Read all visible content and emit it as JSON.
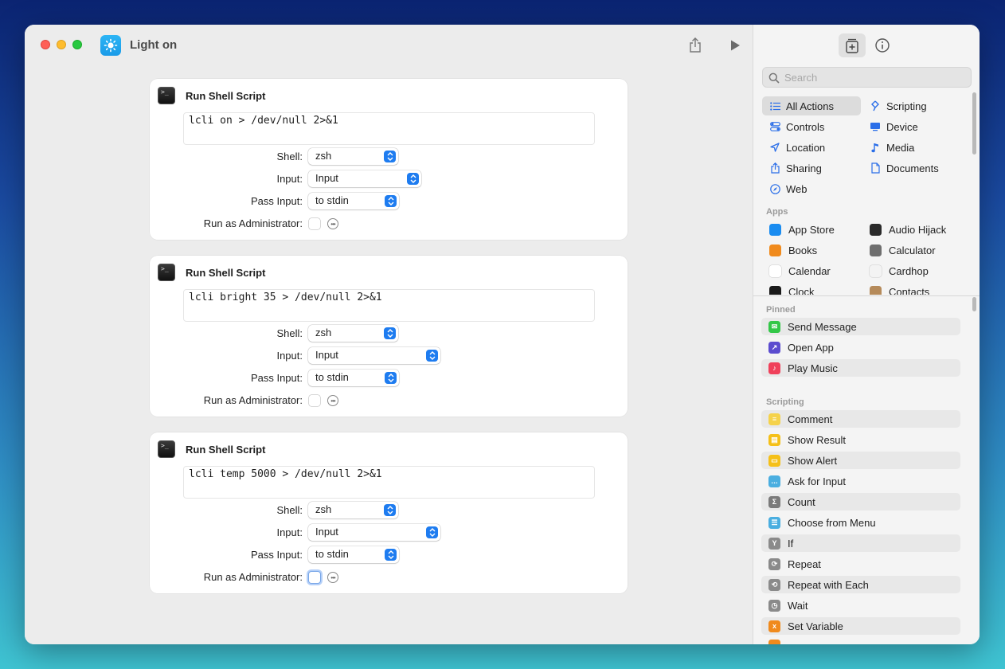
{
  "window": {
    "title": "Light on"
  },
  "cards": [
    {
      "title": "Run Shell Script",
      "script": "lcli on > /dev/null 2>&1",
      "shell_label": "Shell:",
      "shell_value": "zsh",
      "input_label": "Input:",
      "input_value": "Input",
      "pass_label": "Pass Input:",
      "pass_value": "to stdin",
      "admin_label": "Run as Administrator:"
    },
    {
      "title": "Run Shell Script",
      "script": "lcli bright 35 > /dev/null 2>&1",
      "shell_label": "Shell:",
      "shell_value": "zsh",
      "input_label": "Input:",
      "input_value": "Input",
      "pass_label": "Pass Input:",
      "pass_value": "to stdin",
      "admin_label": "Run as Administrator:"
    },
    {
      "title": "Run Shell Script",
      "script": "lcli temp 5000 > /dev/null 2>&1",
      "shell_label": "Shell:",
      "shell_value": "zsh",
      "input_label": "Input:",
      "input_value": "Input",
      "pass_label": "Pass Input:",
      "pass_value": "to stdin",
      "admin_label": "Run as Administrator:"
    }
  ],
  "sidebar": {
    "search_placeholder": "Search",
    "categories": [
      {
        "label": "All Actions",
        "icon": "list-icon"
      },
      {
        "label": "Scripting",
        "icon": "scripting-icon"
      },
      {
        "label": "Controls",
        "icon": "controls-icon"
      },
      {
        "label": "Device",
        "icon": "device-icon"
      },
      {
        "label": "Location",
        "icon": "location-icon"
      },
      {
        "label": "Media",
        "icon": "music-note-icon"
      },
      {
        "label": "Sharing",
        "icon": "share-icon"
      },
      {
        "label": "Documents",
        "icon": "document-icon"
      },
      {
        "label": "Web",
        "icon": "compass-icon"
      }
    ],
    "apps_header": "Apps",
    "apps": [
      {
        "label": "App Store",
        "color": "#1a8cf0"
      },
      {
        "label": "Audio Hijack",
        "color": "#2a2a2a"
      },
      {
        "label": "Books",
        "color": "#f08a1c"
      },
      {
        "label": "Calculator",
        "color": "#6e6e6e"
      },
      {
        "label": "Calendar",
        "color": "#ffffff"
      },
      {
        "label": "Cardhop",
        "color": "#f3f3f3"
      },
      {
        "label": "Clock",
        "color": "#1a1a1a"
      },
      {
        "label": "Contacts",
        "color": "#b58a5a"
      }
    ],
    "pinned_header": "Pinned",
    "pinned": [
      {
        "label": "Send Message",
        "color": "#33c748"
      },
      {
        "label": "Open App",
        "color": "#5b4ccf"
      },
      {
        "label": "Play Music",
        "color": "#f0405a"
      }
    ],
    "scripting_header": "Scripting",
    "scripting": [
      {
        "label": "Comment",
        "color": "#f5d24a"
      },
      {
        "label": "Show Result",
        "color": "#f5c018"
      },
      {
        "label": "Show Alert",
        "color": "#f5c018"
      },
      {
        "label": "Ask for Input",
        "color": "#4aaee0"
      },
      {
        "label": "Count",
        "color": "#7a7a7a"
      },
      {
        "label": "Choose from Menu",
        "color": "#4aaee0"
      },
      {
        "label": "If",
        "color": "#8a8a8a"
      },
      {
        "label": "Repeat",
        "color": "#8a8a8a"
      },
      {
        "label": "Repeat with Each",
        "color": "#8a8a8a"
      },
      {
        "label": "Wait",
        "color": "#8a8a8a"
      },
      {
        "label": "Set Variable",
        "color": "#f08a1c"
      }
    ]
  }
}
